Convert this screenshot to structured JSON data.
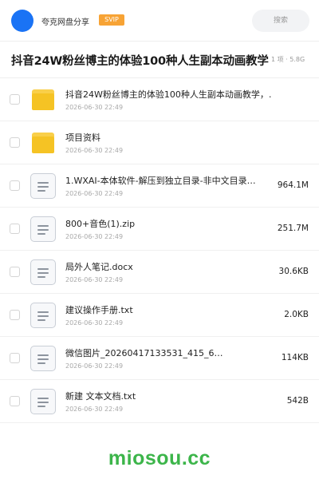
{
  "header": {
    "sharer_name": "夸克网盘分享",
    "vip_badge": "SVIP",
    "search_placeholder": "搜索"
  },
  "share": {
    "title": "抖音24W粉丝博主的体验100种人生副本动画教学",
    "meta": "1 项 · 5.8G"
  },
  "files": [
    {
      "type": "folder",
      "icon": "folder-icon",
      "name": "抖音24W粉丝博主的体验100种人生副本动画教学，…",
      "date": "2026-06-30 22:49",
      "size": ""
    },
    {
      "type": "folder",
      "icon": "folder-icon",
      "name": "项目资料",
      "date": "2026-06-30 22:49",
      "size": ""
    },
    {
      "type": "file",
      "icon": "document-icon",
      "name": "1.WXAI-本体软件-解压到独立目录-非中文目录…",
      "date": "2026-06-30 22:49",
      "size": "964.1M"
    },
    {
      "type": "file",
      "icon": "document-icon",
      "name": "800+音色(1).zip",
      "date": "2026-06-30 22:49",
      "size": "251.7M"
    },
    {
      "type": "file",
      "icon": "document-icon",
      "name": "局外人笔记.docx",
      "date": "2026-06-30 22:49",
      "size": "30.6KB"
    },
    {
      "type": "file",
      "icon": "document-icon",
      "name": "建议操作手册.txt",
      "date": "2026-06-30 22:49",
      "size": "2.0KB"
    },
    {
      "type": "file",
      "icon": "document-icon",
      "name": "微信图片_20260417133531_415_6…",
      "date": "2026-06-30 22:49",
      "size": "114KB"
    },
    {
      "type": "file",
      "icon": "document-icon",
      "name": "新建 文本文档.txt",
      "date": "2026-06-30 22:49",
      "size": "542B"
    }
  ],
  "watermark": "miosou.cc",
  "colors": {
    "accent_blue": "#1a73f5",
    "vip_orange": "#f7a335",
    "folder_yellow": "#f5c324",
    "watermark_green": "#3cb54a"
  }
}
